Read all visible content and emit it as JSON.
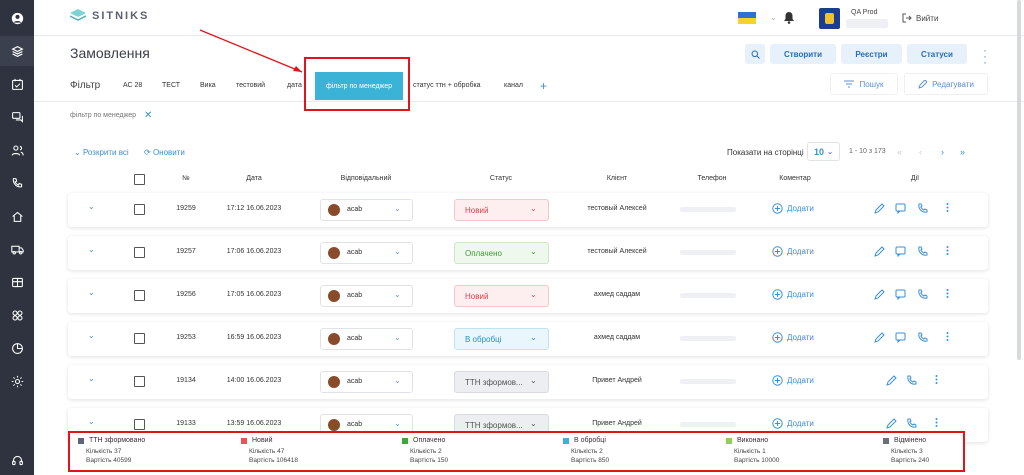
{
  "app": {
    "logo_text": "SITNIKS",
    "user_name": "QA Prod",
    "logout_label": "Вийти"
  },
  "sidebar": {
    "items": [
      "layers-icon",
      "calendar-check-icon",
      "chat-icon",
      "users-icon",
      "phone-icon",
      "home-icon",
      "truck-icon",
      "box-icon",
      "org-icon",
      "chart-icon",
      "gear-icon",
      "headset-icon"
    ]
  },
  "page": {
    "title": "Замовлення"
  },
  "toolbar": {
    "create_label": "Створити",
    "registers_label": "Реєстри",
    "statuses_label": "Статуси"
  },
  "filters": {
    "label": "Фільтр",
    "tabs": [
      "АС 28",
      "ТЕСТ",
      "Вика",
      "тестовий",
      "дата"
    ],
    "active_tab": "фільтр по менеджер",
    "tabs_after": [
      "статус ттн + обробка",
      "канал"
    ],
    "search_label": "Пошук",
    "edit_label": "Редагувати",
    "applied_chip": "фільтр по менеджер"
  },
  "list_controls": {
    "expand_all": "Розкрити всі",
    "refresh": "Оновити",
    "per_page_label": "Показати на сторінці",
    "per_page_value": "10",
    "range": "1 - 10 з 173"
  },
  "table": {
    "headers": {
      "num": "№",
      "date": "Дата",
      "responsible": "Відповідальний",
      "status": "Статус",
      "client": "Клієнт",
      "phone": "Телефон",
      "comment": "Коментар",
      "actions": "Дії"
    },
    "add_comment_label": "Додати",
    "rows": [
      {
        "num": "19259",
        "date": "17:12 16.06.2023",
        "responsible": "acab",
        "status": "Новий",
        "client": "тестовый Алексей"
      },
      {
        "num": "19257",
        "date": "17:06 16.06.2023",
        "responsible": "acab",
        "status": "Оплачено",
        "client": "тестовый Алексей"
      },
      {
        "num": "19256",
        "date": "17:05 16.06.2023",
        "responsible": "acab",
        "status": "Новий",
        "client": "ахмед саддам"
      },
      {
        "num": "19253",
        "date": "16:59 16.06.2023",
        "responsible": "acab",
        "status": "В обробці",
        "client": "ахмед саддам"
      },
      {
        "num": "19134",
        "date": "14:00 16.06.2023",
        "responsible": "acab",
        "status": "ТТН зформов...",
        "client": "Привет Андрей"
      },
      {
        "num": "19133",
        "date": "13:59 16.06.2023",
        "responsible": "acab",
        "status": "ТТН зформов...",
        "client": "Привет Андрей"
      }
    ]
  },
  "status_colors": {
    "Новий": {
      "bg": "#fdeff0",
      "border": "#f5c7cb",
      "text": "#d9434e"
    },
    "Оплачено": {
      "bg": "#eef8ec",
      "border": "#cde8c6",
      "text": "#3f9a35"
    },
    "В обробці": {
      "bg": "#e9f6fb",
      "border": "#bfe3f1",
      "text": "#2b8fb5"
    },
    "ТТН зформов...": {
      "bg": "#eceef1",
      "border": "#d8dce1",
      "text": "#555"
    }
  },
  "summary": [
    {
      "name": "ТТН зформовано",
      "color": "#5e6479",
      "count_label": "Кількість 37",
      "value_label": "Вартість 40599"
    },
    {
      "name": "Новий",
      "color": "#e8535a",
      "count_label": "Кількість 47",
      "value_label": "Вартість 106418"
    },
    {
      "name": "Оплачено",
      "color": "#3ea63a",
      "count_label": "Кількість 2",
      "value_label": "Вартість 150"
    },
    {
      "name": "В обробці",
      "color": "#3ab3d6",
      "count_label": "Кількість 2",
      "value_label": "Вартість 850"
    },
    {
      "name": "Виконано",
      "color": "#8fd14f",
      "count_label": "Кількість 1",
      "value_label": "Вартість 10000"
    },
    {
      "name": "Відмінено",
      "color": "#6b6f78",
      "count_label": "Кількість 3",
      "value_label": "Вартість 240"
    }
  ]
}
